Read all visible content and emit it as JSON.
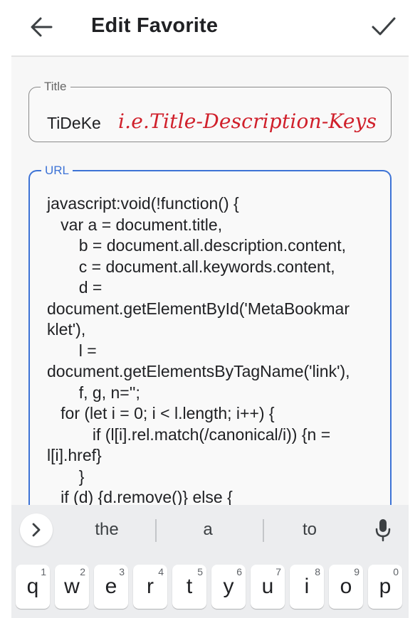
{
  "header": {
    "title": "Edit Favorite",
    "back_icon": "arrow-left-icon",
    "confirm_icon": "checkmark-icon"
  },
  "title_field": {
    "label": "Title",
    "value": "TiDeKe",
    "hint": "i.e.Title-Description-Keys"
  },
  "url_field": {
    "label": "URL",
    "value": "javascript:void(!function() {\n   var a = document.title,\n       b = document.all.description.content,\n       c = document.all.keywords.content,\n       d =\ndocument.getElementById('MetaBookmar\nklet'),\n       l =\ndocument.getElementsByTagName('link'),\n       f, g, n='';\n   for (let i = 0; i < l.length; i++) {\n          if (l[i].rel.match(/canonical/i)) {n =\nl[i].href}\n       }\n   if (d) {d.remove()} else {"
  },
  "keyboard": {
    "suggestions": [
      "the",
      "a",
      "to"
    ],
    "keys": [
      {
        "letter": "q",
        "num": "1"
      },
      {
        "letter": "w",
        "num": "2"
      },
      {
        "letter": "e",
        "num": "3"
      },
      {
        "letter": "r",
        "num": "4"
      },
      {
        "letter": "t",
        "num": "5"
      },
      {
        "letter": "y",
        "num": "6"
      },
      {
        "letter": "u",
        "num": "7"
      },
      {
        "letter": "i",
        "num": "8"
      },
      {
        "letter": "o",
        "num": "9"
      },
      {
        "letter": "p",
        "num": "0"
      }
    ]
  },
  "colors": {
    "accent": "#3d73d6",
    "hint_red": "#d0202b",
    "keyboard_bg": "#ecedef"
  }
}
